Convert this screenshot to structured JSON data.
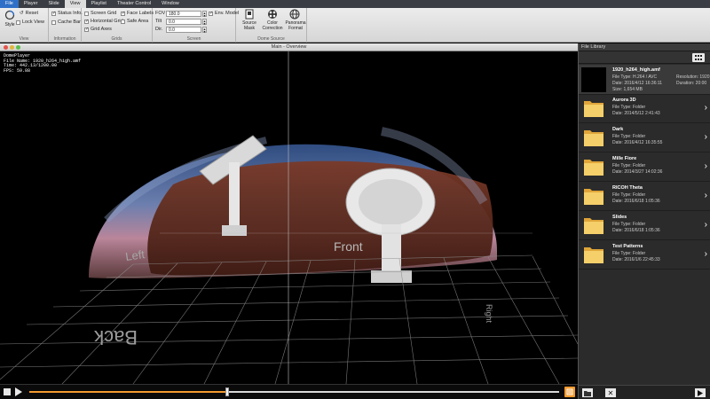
{
  "tabs": [
    "File",
    "Player",
    "Slide",
    "View",
    "Playlist",
    "Theater Control",
    "Window"
  ],
  "active_tab": "View",
  "ribbon": {
    "view_group": {
      "label": "View",
      "style_label": "Style",
      "reset": "Reset",
      "lock_view": "Lock View"
    },
    "information_group": {
      "label": "Information",
      "status_info": "Status Info.",
      "cache_bar": "Cache Bar"
    },
    "grids_group": {
      "label": "Grids",
      "screen_grid": "Screen Grid",
      "horizontal_grid": "Horizontal Grid",
      "grid_axes": "Grid Axes",
      "face_labels": "Face Labels",
      "safe_area": "Safe Area"
    },
    "screen_group": {
      "label": "Screen",
      "fov_label": "FOV",
      "fov_value": "180.0",
      "tilt_label": "Tilt",
      "tilt_value": "0.0",
      "dir_label": "Dir.",
      "dir_value": "0.0",
      "env_model": "Env. Model"
    },
    "dome_source_group": {
      "label": "Dome Source",
      "source_mask": "Source Mask",
      "color_correction": "Color Correction",
      "panorama_format": "Panorama Format"
    }
  },
  "window_title": "Main - Overview",
  "info": {
    "app": "DomePlayer",
    "file_name": "File Name: 1920_h264_high.amf",
    "time": "Time:  442.13/1200.00",
    "fps": "FPS: 59.88"
  },
  "face_labels": {
    "front": "Front",
    "left": "Left",
    "back": "Back",
    "right": "Right"
  },
  "playback": {
    "progress": 0.373
  },
  "library": {
    "title": "File Library",
    "media": {
      "name": "1920_h264_high.amf",
      "file_type": "File Type: H.264 / AVC",
      "date": "Date: 2016/4/12 16:36:11",
      "size": "Size: 1,654 MB",
      "resolution": "Resolution: 1920",
      "duration": "Duration: 20:00"
    },
    "folders": [
      {
        "name": "Aurora 3D",
        "type": "File Type: Folder",
        "date": "Date: 2014/5/12 2:41:43"
      },
      {
        "name": "Dark",
        "type": "File Type: Folder",
        "date": "Date: 2016/4/12 16:35:55"
      },
      {
        "name": "Mille Fiore",
        "type": "File Type: Folder",
        "date": "Date: 2014/3/27 14:02:36"
      },
      {
        "name": "RICOH Theta",
        "type": "File Type: Folder",
        "date": "Date: 2016/6/18 1:05:36"
      },
      {
        "name": "Slides",
        "type": "File Type: Folder",
        "date": "Date: 2016/6/18 1:05:36"
      },
      {
        "name": "Test Patterns",
        "type": "File Type: Folder",
        "date": "Date: 2016/1/6 22:45:33"
      }
    ]
  },
  "colors": {
    "accent": "#f29a2e",
    "file_tab": "#2f6fc7",
    "panel": "#2b2b2b"
  }
}
